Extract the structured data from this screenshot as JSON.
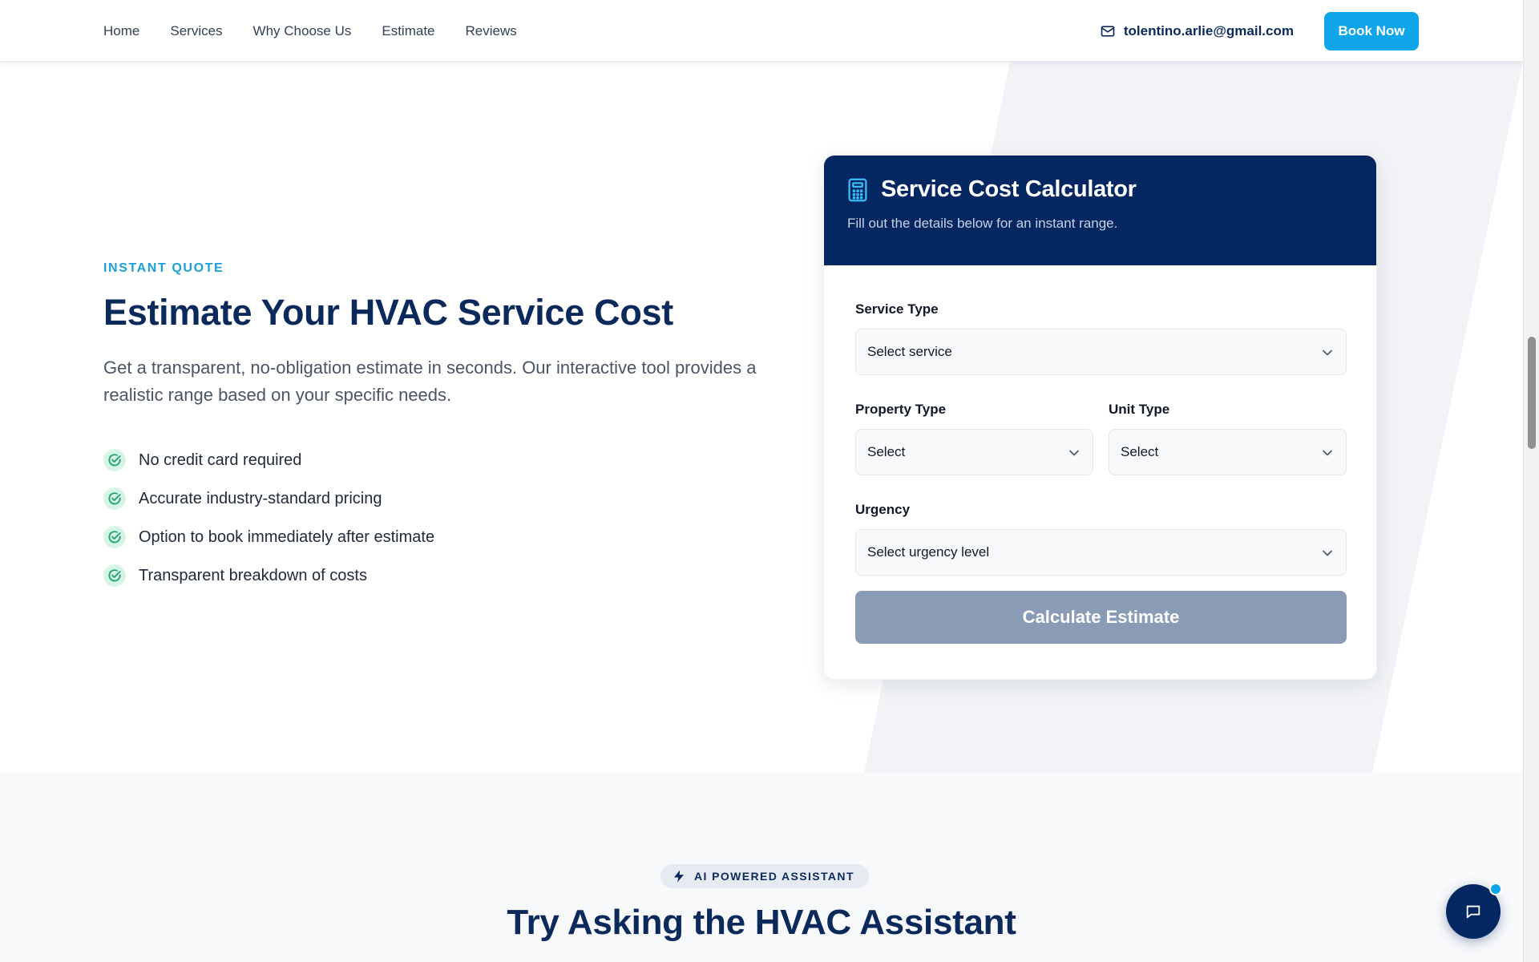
{
  "nav": {
    "links": [
      "Home",
      "Services",
      "Why Choose Us",
      "Estimate",
      "Reviews"
    ],
    "email": "tolentino.arlie@gmail.com",
    "email_icon": "mail-icon",
    "book_label": "Book Now"
  },
  "hero": {
    "eyebrow": "INSTANT QUOTE",
    "title": "Estimate Your HVAC Service Cost",
    "description": "Get a transparent, no-obligation estimate in seconds. Our interactive tool provides a realistic range based on your specific needs.",
    "features": [
      "No credit card required",
      "Accurate industry-standard pricing",
      "Option to book immediately after estimate",
      "Transparent breakdown of costs"
    ],
    "feature_icon": "check-circle-icon"
  },
  "calculator": {
    "icon": "calculator-icon",
    "title": "Service Cost Calculator",
    "subtitle": "Fill out the details below for an instant range.",
    "service_type": {
      "label": "Service Type",
      "value": "Select service"
    },
    "property_type": {
      "label": "Property Type",
      "value": "Select"
    },
    "unit_type": {
      "label": "Unit Type",
      "value": "Select"
    },
    "urgency": {
      "label": "Urgency",
      "value": "Select urgency level"
    },
    "submit_label": "Calculate Estimate"
  },
  "assistant": {
    "badge_icon": "lightning-icon",
    "badge": "AI POWERED ASSISTANT",
    "title": "Try Asking the HVAC Assistant"
  },
  "chat": {
    "icon": "chat-bubble-icon"
  },
  "colors": {
    "navy": "#042661",
    "accent": "#0ea5e9",
    "heading": "#0b2a5b",
    "disabled_button": "#8a9bb6",
    "check_bg": "#d7f5e6",
    "check": "#1aa36b"
  }
}
